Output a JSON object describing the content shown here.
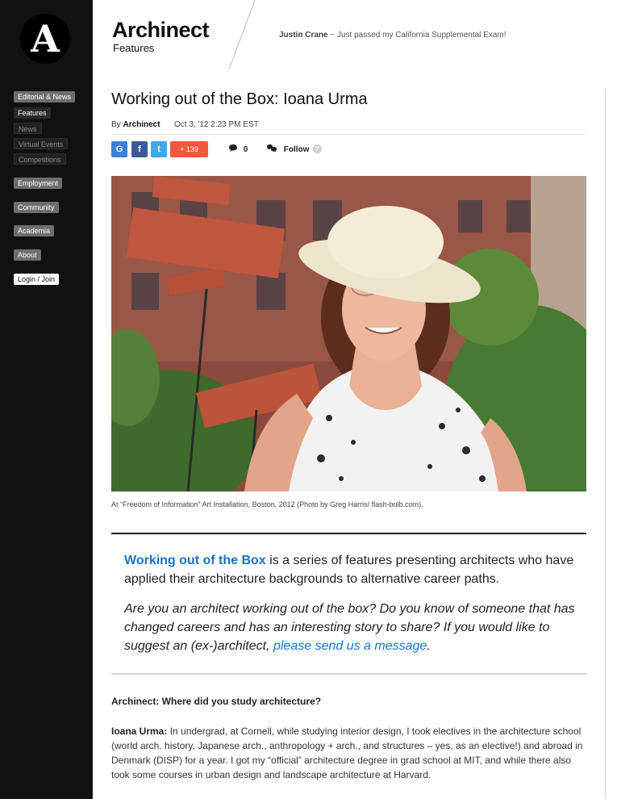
{
  "sidebar": {
    "logo_letter": "A",
    "items": [
      {
        "label": "Editorial & News"
      },
      {
        "label": "Features"
      },
      {
        "label": "News"
      },
      {
        "label": "Virtual Events"
      },
      {
        "label": "Competitions"
      },
      {
        "label": "Employment"
      },
      {
        "label": "Community"
      },
      {
        "label": "Academia"
      },
      {
        "label": "About"
      }
    ],
    "login_label": "Login / Join"
  },
  "header": {
    "brand": "Archinect",
    "section": "Features",
    "ticker_user": "Justin Crane",
    "ticker_text": "~ Just passed my California Supplemental Exam!"
  },
  "article": {
    "title": "Working out of the Box: Ioana Urma",
    "by_prefix": "By",
    "author": "Archinect",
    "date": "Oct 3, '12 2:23 PM EST",
    "share": {
      "google": "G",
      "facebook": "f",
      "twitter": "t",
      "plus_count": "+ 139",
      "comments_count": "0",
      "follow_label": "Follow",
      "help": "?"
    },
    "photo_caption": "At “Freedom of Information” Art Installation, Boston, 2012 (Photo by Greg Harris/ flash-bulb.com).",
    "intro_link": "Working out of the Box",
    "intro_rest": " is a series of features presenting architects who have applied their architecture backgrounds to alternative career paths.",
    "intro2_text": "Are you an architect working out of the box? Do you know of someone that has changed careers and has an interesting story to share? If you would like to suggest an (ex-)architect, ",
    "intro2_link": "please send us a message",
    "intro2_end": ".",
    "question1": "Archinect: Where did you study architecture?",
    "answer1_name": "Ioana Urma:",
    "answer1_text": " In undergrad, at Cornell, while studying interior design, I took electives in the architecture school (world arch. history, Japanese arch., anthropology + arch., and structures – yes, as an elective!) and abroad in Denmark (DISP) for a year. I got my “official” architecture degree in grad school at MIT, and while there also took some courses in urban design and landscape architecture at Harvard."
  },
  "colors": {
    "sidebar_bg": "#111111",
    "link_blue": "#1a73c8",
    "share_google": "#3b82d6",
    "share_facebook": "#3b5b98",
    "share_twitter": "#3fa9e6",
    "share_plus": "#f05a3c"
  }
}
